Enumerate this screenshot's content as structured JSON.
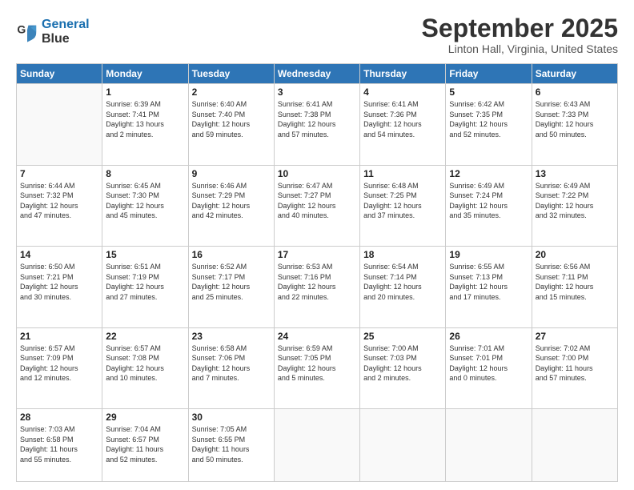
{
  "header": {
    "logo_line1": "General",
    "logo_line2": "Blue",
    "month_title": "September 2025",
    "location": "Linton Hall, Virginia, United States"
  },
  "weekdays": [
    "Sunday",
    "Monday",
    "Tuesday",
    "Wednesday",
    "Thursday",
    "Friday",
    "Saturday"
  ],
  "weeks": [
    [
      {
        "day": "",
        "info": ""
      },
      {
        "day": "1",
        "info": "Sunrise: 6:39 AM\nSunset: 7:41 PM\nDaylight: 13 hours\nand 2 minutes."
      },
      {
        "day": "2",
        "info": "Sunrise: 6:40 AM\nSunset: 7:40 PM\nDaylight: 12 hours\nand 59 minutes."
      },
      {
        "day": "3",
        "info": "Sunrise: 6:41 AM\nSunset: 7:38 PM\nDaylight: 12 hours\nand 57 minutes."
      },
      {
        "day": "4",
        "info": "Sunrise: 6:41 AM\nSunset: 7:36 PM\nDaylight: 12 hours\nand 54 minutes."
      },
      {
        "day": "5",
        "info": "Sunrise: 6:42 AM\nSunset: 7:35 PM\nDaylight: 12 hours\nand 52 minutes."
      },
      {
        "day": "6",
        "info": "Sunrise: 6:43 AM\nSunset: 7:33 PM\nDaylight: 12 hours\nand 50 minutes."
      }
    ],
    [
      {
        "day": "7",
        "info": "Sunrise: 6:44 AM\nSunset: 7:32 PM\nDaylight: 12 hours\nand 47 minutes."
      },
      {
        "day": "8",
        "info": "Sunrise: 6:45 AM\nSunset: 7:30 PM\nDaylight: 12 hours\nand 45 minutes."
      },
      {
        "day": "9",
        "info": "Sunrise: 6:46 AM\nSunset: 7:29 PM\nDaylight: 12 hours\nand 42 minutes."
      },
      {
        "day": "10",
        "info": "Sunrise: 6:47 AM\nSunset: 7:27 PM\nDaylight: 12 hours\nand 40 minutes."
      },
      {
        "day": "11",
        "info": "Sunrise: 6:48 AM\nSunset: 7:25 PM\nDaylight: 12 hours\nand 37 minutes."
      },
      {
        "day": "12",
        "info": "Sunrise: 6:49 AM\nSunset: 7:24 PM\nDaylight: 12 hours\nand 35 minutes."
      },
      {
        "day": "13",
        "info": "Sunrise: 6:49 AM\nSunset: 7:22 PM\nDaylight: 12 hours\nand 32 minutes."
      }
    ],
    [
      {
        "day": "14",
        "info": "Sunrise: 6:50 AM\nSunset: 7:21 PM\nDaylight: 12 hours\nand 30 minutes."
      },
      {
        "day": "15",
        "info": "Sunrise: 6:51 AM\nSunset: 7:19 PM\nDaylight: 12 hours\nand 27 minutes."
      },
      {
        "day": "16",
        "info": "Sunrise: 6:52 AM\nSunset: 7:17 PM\nDaylight: 12 hours\nand 25 minutes."
      },
      {
        "day": "17",
        "info": "Sunrise: 6:53 AM\nSunset: 7:16 PM\nDaylight: 12 hours\nand 22 minutes."
      },
      {
        "day": "18",
        "info": "Sunrise: 6:54 AM\nSunset: 7:14 PM\nDaylight: 12 hours\nand 20 minutes."
      },
      {
        "day": "19",
        "info": "Sunrise: 6:55 AM\nSunset: 7:13 PM\nDaylight: 12 hours\nand 17 minutes."
      },
      {
        "day": "20",
        "info": "Sunrise: 6:56 AM\nSunset: 7:11 PM\nDaylight: 12 hours\nand 15 minutes."
      }
    ],
    [
      {
        "day": "21",
        "info": "Sunrise: 6:57 AM\nSunset: 7:09 PM\nDaylight: 12 hours\nand 12 minutes."
      },
      {
        "day": "22",
        "info": "Sunrise: 6:57 AM\nSunset: 7:08 PM\nDaylight: 12 hours\nand 10 minutes."
      },
      {
        "day": "23",
        "info": "Sunrise: 6:58 AM\nSunset: 7:06 PM\nDaylight: 12 hours\nand 7 minutes."
      },
      {
        "day": "24",
        "info": "Sunrise: 6:59 AM\nSunset: 7:05 PM\nDaylight: 12 hours\nand 5 minutes."
      },
      {
        "day": "25",
        "info": "Sunrise: 7:00 AM\nSunset: 7:03 PM\nDaylight: 12 hours\nand 2 minutes."
      },
      {
        "day": "26",
        "info": "Sunrise: 7:01 AM\nSunset: 7:01 PM\nDaylight: 12 hours\nand 0 minutes."
      },
      {
        "day": "27",
        "info": "Sunrise: 7:02 AM\nSunset: 7:00 PM\nDaylight: 11 hours\nand 57 minutes."
      }
    ],
    [
      {
        "day": "28",
        "info": "Sunrise: 7:03 AM\nSunset: 6:58 PM\nDaylight: 11 hours\nand 55 minutes."
      },
      {
        "day": "29",
        "info": "Sunrise: 7:04 AM\nSunset: 6:57 PM\nDaylight: 11 hours\nand 52 minutes."
      },
      {
        "day": "30",
        "info": "Sunrise: 7:05 AM\nSunset: 6:55 PM\nDaylight: 11 hours\nand 50 minutes."
      },
      {
        "day": "",
        "info": ""
      },
      {
        "day": "",
        "info": ""
      },
      {
        "day": "",
        "info": ""
      },
      {
        "day": "",
        "info": ""
      }
    ]
  ]
}
